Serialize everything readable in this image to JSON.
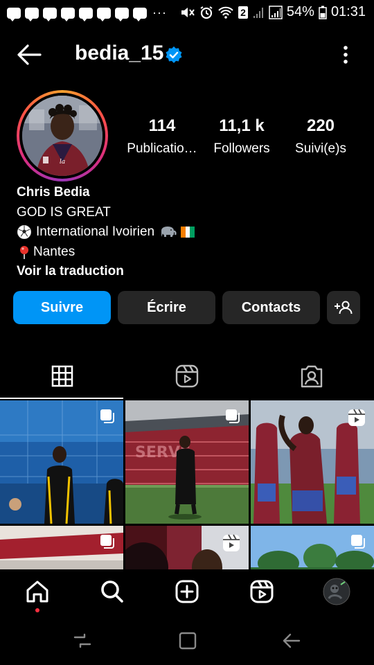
{
  "status_bar": {
    "dots": "···",
    "sim_badge": "2",
    "battery": "54%",
    "time": "01:31"
  },
  "header": {
    "username": "bedia_15",
    "back_icon": "back-arrow-icon",
    "menu_icon": "kebab-menu-icon",
    "verified_color": "#0095f6"
  },
  "stats": [
    {
      "value": "114",
      "label": "Publicatio…"
    },
    {
      "value": "11,1 k",
      "label": "Followers"
    },
    {
      "value": "220",
      "label": "Suivi(e)s"
    }
  ],
  "bio": {
    "name": "Chris Bedia",
    "line1": "GOD IS GREAT",
    "line2": "International Ivoirien",
    "line3": "Nantes",
    "translate": "Voir la traduction"
  },
  "buttons": {
    "follow": "Suivre",
    "message": "Écrire",
    "contacts": "Contacts",
    "suggest_icon": "add-person-icon"
  },
  "tabs": [
    {
      "icon": "grid-icon",
      "active": true
    },
    {
      "icon": "reels-icon",
      "active": false
    },
    {
      "icon": "tagged-icon",
      "active": false
    }
  ],
  "bottom_nav": [
    "home-icon",
    "search-icon",
    "create-icon",
    "reels-icon",
    "profile-avatar"
  ],
  "colors": {
    "accent": "#0095f6",
    "button_bg": "#262626",
    "background": "#000000"
  }
}
